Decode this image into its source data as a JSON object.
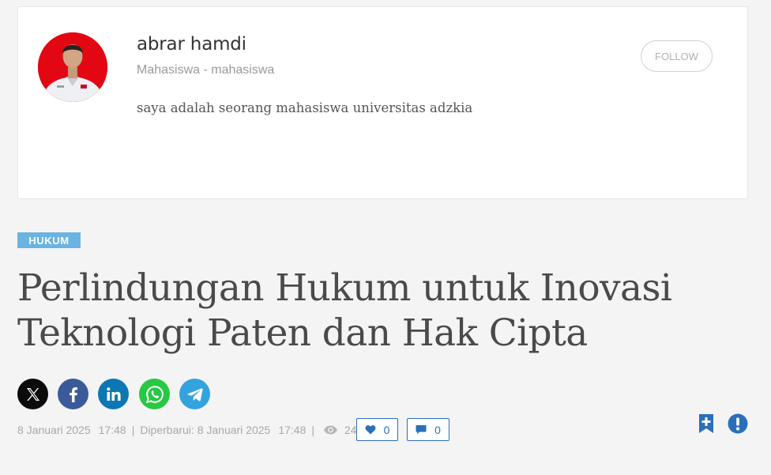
{
  "profile": {
    "name": "abrar hamdi",
    "role": "Mahasiswa - mahasiswa",
    "bio": "saya adalah seorang mahasiswa universitas adzkia",
    "follow_label": "FOLLOW"
  },
  "article": {
    "category": "HUKUM",
    "title_line1": "Perlindungan Hukum untuk Inovasi",
    "title_line2": "Teknologi Paten dan Hak Cipta"
  },
  "share": {
    "icons": [
      "x-icon",
      "facebook-icon",
      "linkedin-icon",
      "whatsapp-icon",
      "telegram-icon"
    ]
  },
  "meta": {
    "published_date": "8 Januari 2025",
    "published_time": "17:48",
    "sep": "|",
    "updated_label": "Diperbarui: 8 Januari 2025",
    "updated_time": "17:48",
    "views": "24",
    "likes": "0",
    "comments": "0"
  },
  "colors": {
    "accent_blue": "#2a70b8",
    "badge_blue": "#6bb3e3",
    "avatar_bg": "#e30613"
  }
}
